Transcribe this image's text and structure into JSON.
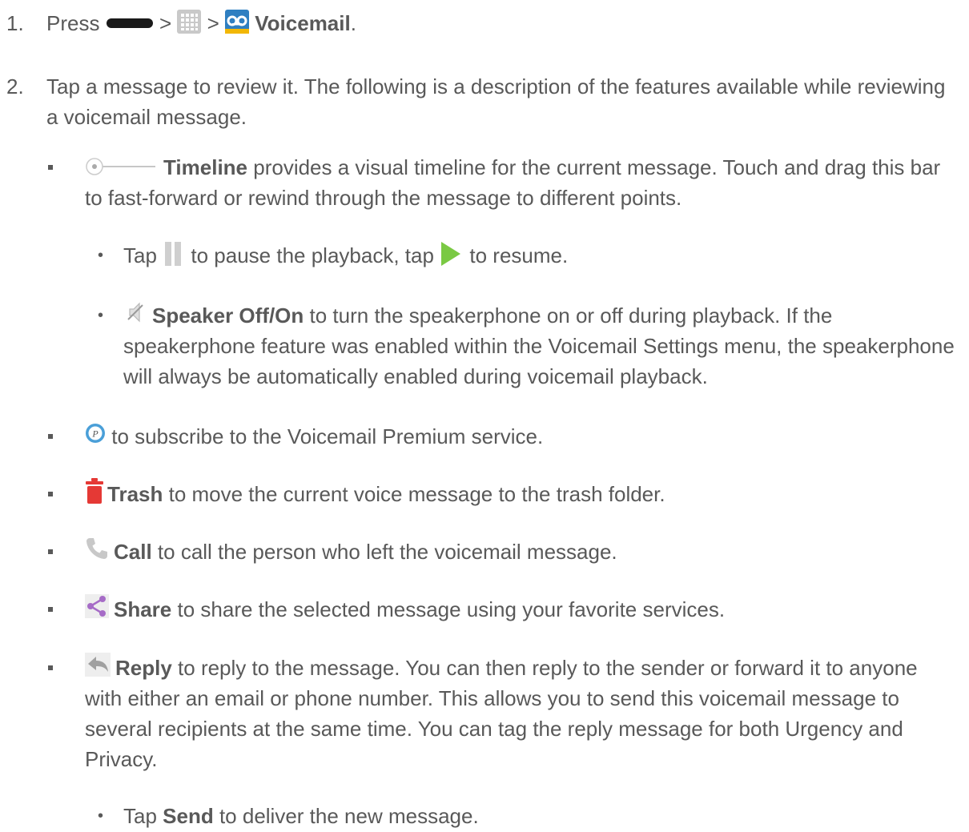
{
  "step1": {
    "number": "1.",
    "press": "Press",
    "sep1": ">",
    "sep2": ">",
    "voicemail_label": "Voicemail",
    "period": "."
  },
  "step2": {
    "number": "2.",
    "text": "Tap a message to review it. The following is a description of the features available while reviewing a voicemail message."
  },
  "features": {
    "timeline": {
      "label": "Timeline",
      "text": " provides a visual timeline for the current message. Touch and drag this bar to fast-forward or rewind through the message to different points."
    },
    "pause_resume": {
      "tap": "Tap",
      "mid": " to pause the playback, tap ",
      "end": " to resume."
    },
    "speaker": {
      "label": "Speaker Off/On",
      "text": " to turn the speakerphone on or off during playback. If the speakerphone feature was enabled within the Voicemail Settings menu, the speakerphone will always be automatically enabled during voicemail playback."
    },
    "premium": {
      "text": " to subscribe to the Voicemail Premium service."
    },
    "trash": {
      "label": "Trash",
      "text": " to move the current voice message to the trash folder."
    },
    "call": {
      "label": "Call",
      "text": " to call the person who left the voicemail message."
    },
    "share": {
      "label": "Share",
      "text": " to share the selected message using your favorite services."
    },
    "reply": {
      "label": "Reply",
      "text": " to reply to the message. You can then reply to the sender or forward it to anyone with either an email or phone number. This allows you to send this voicemail message to several recipients at the same time. You can tag the reply message for both Urgency and Privacy."
    },
    "send": {
      "tap": "Tap ",
      "label": "Send",
      "text": " to deliver the new message."
    }
  },
  "bullets": {
    "square": "",
    "dot": "•"
  },
  "icons": {
    "home_key": "home-key-icon",
    "apps": "apps-grid-icon",
    "voicemail": "voicemail-icon",
    "timeline": "timeline-slider-icon",
    "pause": "pause-icon",
    "play": "play-icon",
    "speaker": "speaker-off-icon",
    "premium": "premium-icon",
    "trash": "trash-icon",
    "call": "phone-icon",
    "share": "share-icon",
    "reply": "reply-icon"
  },
  "colors": {
    "text": "#595959",
    "play": "#7ac943",
    "trash": "#e53935",
    "share": "#a66cc7",
    "voicemail_bg": "#2f7fc1"
  }
}
